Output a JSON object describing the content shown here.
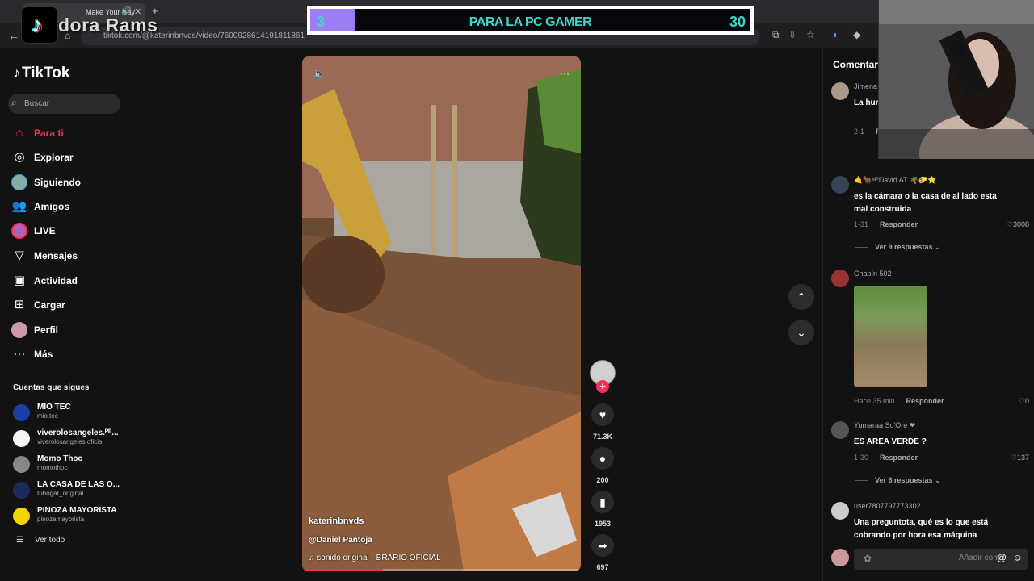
{
  "browser": {
    "tab_title": "Make Your Day",
    "url": "tiktok.com/@katerinbnvds/video/7600928614191811861"
  },
  "overlay": {
    "streamer": "dora Rams",
    "goal_current": "3",
    "goal_label": "PARA LA PC GAMER",
    "goal_target": "30",
    "goal_progress": 0.1
  },
  "sidebar": {
    "logo": "TikTok",
    "search_placeholder": "Buscar",
    "nav": [
      {
        "label": "Para ti",
        "icon": "home-icon"
      },
      {
        "label": "Explorar",
        "icon": "compass-icon"
      },
      {
        "label": "Siguiendo",
        "icon": "following-icon"
      },
      {
        "label": "Amigos",
        "icon": "friends-icon"
      },
      {
        "label": "LIVE",
        "icon": "live-icon"
      },
      {
        "label": "Mensajes",
        "icon": "messages-icon"
      },
      {
        "label": "Actividad",
        "icon": "activity-icon"
      },
      {
        "label": "Cargar",
        "icon": "upload-icon"
      },
      {
        "label": "Perfil",
        "icon": "profile-icon"
      },
      {
        "label": "Más",
        "icon": "more-icon"
      }
    ],
    "following_title": "Cuentas que sigues",
    "accounts": [
      {
        "name": "MIO TEC",
        "handle": "mio.tec",
        "color": "#1b3ea8"
      },
      {
        "name": "viverolosangeles.ᴾᴱ...",
        "handle": "viverolosangeles.oficial",
        "color": "#f4f4f4"
      },
      {
        "name": "Momo Thoc",
        "handle": "momothoc",
        "color": "#888888"
      },
      {
        "name": "LA CASA DE LAS O...",
        "handle": "tuhogar_original",
        "color": "#1a2a5a"
      },
      {
        "name": "PINOZA MAYORISTA",
        "handle": "pinozamayorista",
        "color": "#f2d400"
      }
    ],
    "see_all": "Ver todo"
  },
  "video": {
    "username": "katerinbnvds",
    "tag": "@Daniel Pantoja",
    "sound": "sonido original - BRARIO OFICIAL",
    "progress": 0.29
  },
  "actions": {
    "likes": "71.3K",
    "comments": "200",
    "saves": "1953",
    "shares": "697"
  },
  "comments": {
    "title": "Comentarios",
    "items": [
      {
        "user": "Jimena",
        "text": "La hum... fatal",
        "date": "2-1",
        "reply": "Re",
        "likes": "",
        "more": ""
      },
      {
        "user": "🤙🐂ᴹᴾDavid AT 🌴🌮⭐",
        "text": "es la cámara o la casa de al lado esta mal construida",
        "date": "1-31",
        "reply": "Responder",
        "likes": "3008",
        "more": "Ver 9 respuestas ⌄"
      },
      {
        "user": "Chapín 502",
        "text": "",
        "date": "Hace 35 min",
        "reply": "Responder",
        "likes": "0",
        "more": ""
      },
      {
        "user": "Yumaraa So'Ore ❤",
        "text": "ES AREA VERDE ?",
        "date": "1-30",
        "reply": "Responder",
        "likes": "137",
        "more": "Ver 6 respuestas ⌄"
      },
      {
        "user": "user7807797773302",
        "text": "Una preguntota, qué es lo que está cobrando por hora esa máquina",
        "date": "",
        "reply": "",
        "likes": "",
        "more": ""
      }
    ],
    "input_placeholder": "Añadir comentario..."
  },
  "colors": {
    "accent": "#fe2c55",
    "goal_text": "#3ed6c6",
    "goal_fill": "#9c7df7"
  }
}
